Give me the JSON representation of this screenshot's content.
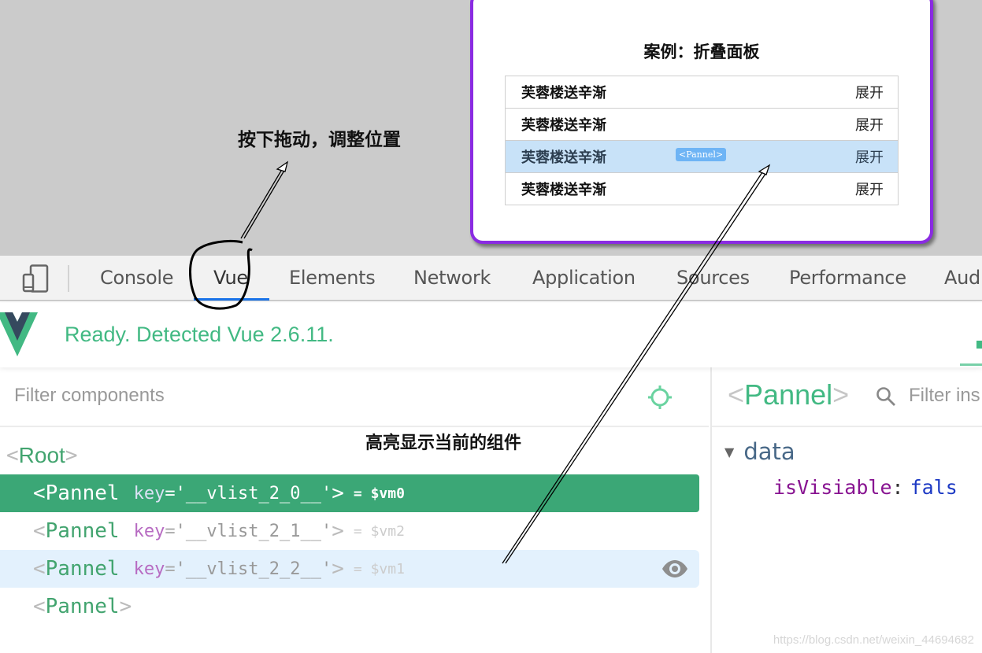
{
  "demo": {
    "title": "案例：折叠面板",
    "panels": [
      {
        "title": "芙蓉楼送辛渐",
        "toggle": "展开"
      },
      {
        "title": "芙蓉楼送辛渐",
        "toggle": "展开"
      },
      {
        "title": "芙蓉楼送辛渐",
        "toggle": "展开"
      },
      {
        "title": "芙蓉楼送辛渐",
        "toggle": "展开"
      }
    ],
    "highlight_tag": "<Pannel>"
  },
  "annotations": {
    "drag_hint": "按下拖动，调整位置",
    "highlight_hint": "高亮显示当前的组件"
  },
  "devtools": {
    "tabs": [
      {
        "label": "Console",
        "active": false
      },
      {
        "label": "Vue",
        "active": true
      },
      {
        "label": "Elements",
        "active": false
      },
      {
        "label": "Network",
        "active": false
      },
      {
        "label": "Application",
        "active": false
      },
      {
        "label": "Sources",
        "active": false
      },
      {
        "label": "Performance",
        "active": false
      },
      {
        "label": "Aud",
        "active": false
      }
    ],
    "status": "Ready. Detected Vue 2.6.11.",
    "filter_placeholder": "Filter components",
    "tree": {
      "root": {
        "open": "<",
        "name": "Root",
        "close": ">"
      },
      "items": [
        {
          "open": "<",
          "name": "Pannel",
          "key_label": "key",
          "eq": "=",
          "key_value": "'__vlist_2_0__'",
          "close": ">",
          "vm": "= $vm0",
          "state": "selected"
        },
        {
          "open": "<",
          "name": "Pannel",
          "key_label": "key",
          "eq": "=",
          "key_value": "'__vlist_2_1__'",
          "close": ">",
          "vm": "= $vm2",
          "state": "normal"
        },
        {
          "open": "<",
          "name": "Pannel",
          "key_label": "key",
          "eq": "=",
          "key_value": "'__vlist_2_2__'",
          "close": ">",
          "vm": "= $vm1",
          "state": "hovered"
        },
        {
          "open": "<",
          "name": "Pannel",
          "close": ">",
          "state": "normal"
        }
      ]
    },
    "inspector": {
      "component_open": "<",
      "component_name": "Pannel",
      "component_close": ">",
      "filter_placeholder": "Filter ins",
      "section_toggle": "▼",
      "section_title": "data",
      "prop_key": "isVisiable",
      "prop_colon": ":",
      "prop_value": "fals"
    },
    "watermark": "https://blog.csdn.net/weixin_44694682"
  },
  "colors": {
    "vue_green": "#42b983",
    "selected_row": "#3ba776",
    "hover_row": "#e3f1fd",
    "active_tab_underline": "#1a73e8",
    "demo_border": "#8a2be2"
  }
}
